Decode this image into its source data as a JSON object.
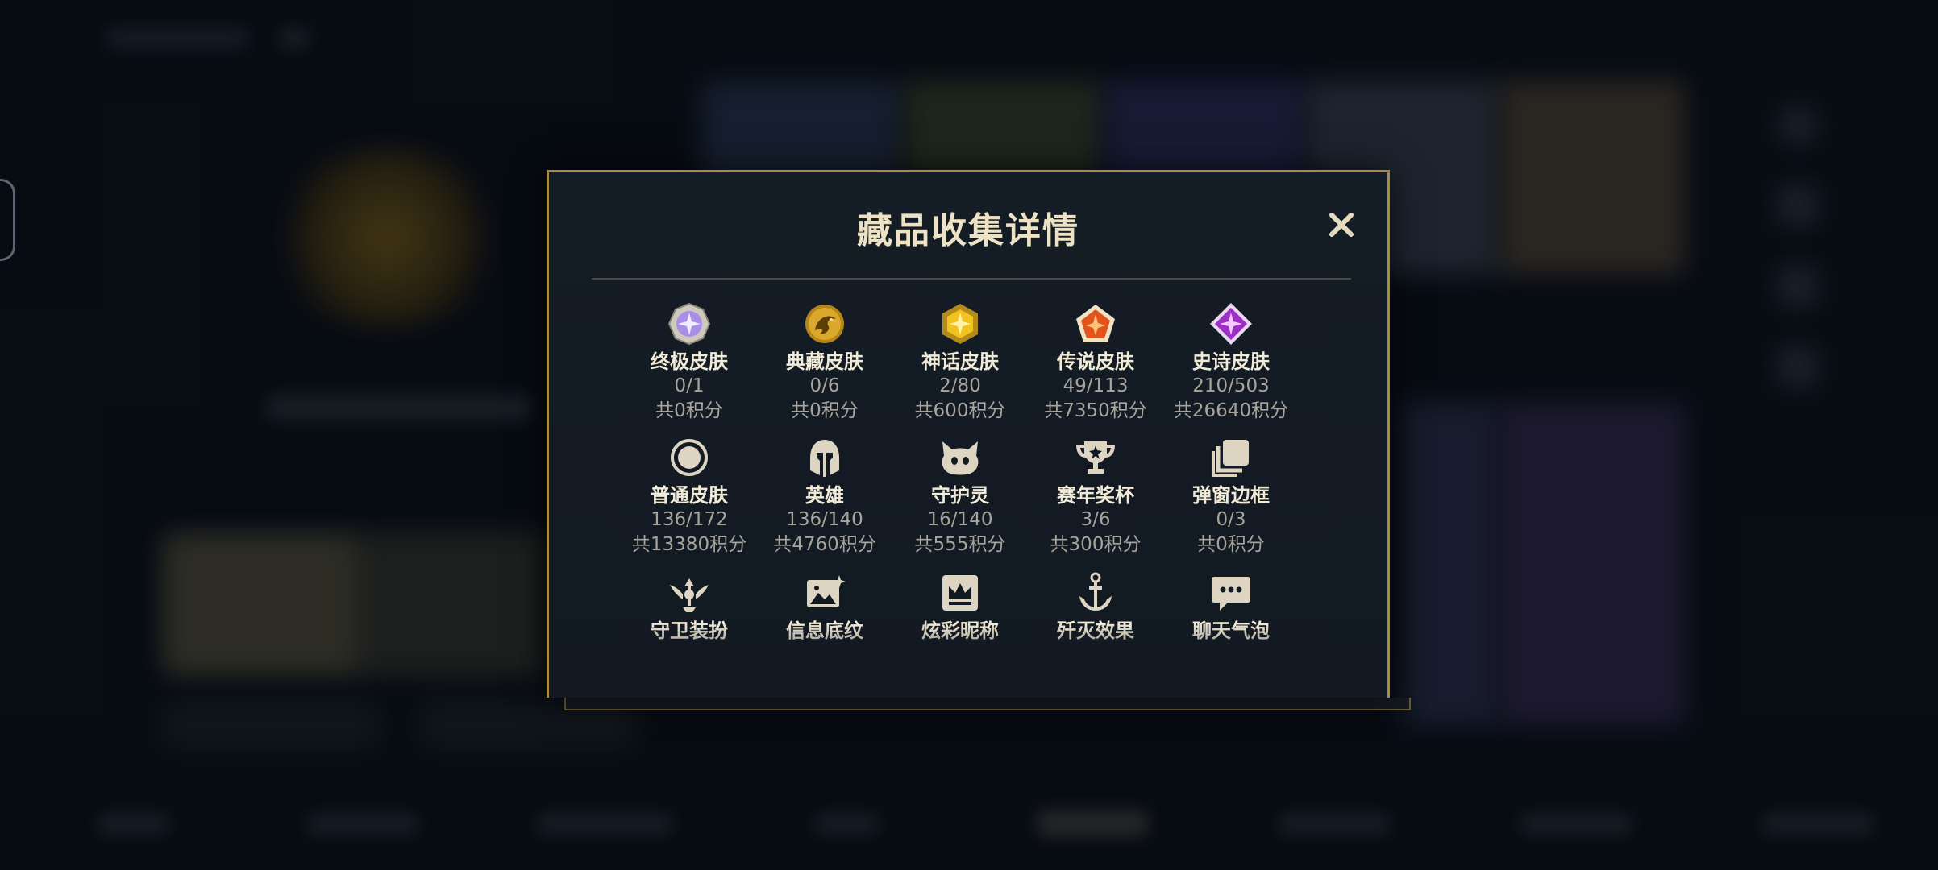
{
  "modal": {
    "title": "藏品收集详情",
    "close_label": "✕"
  },
  "categories": [
    {
      "name": "终极皮肤",
      "count": "0/1",
      "points": "共0积分",
      "icon": "ultimate-gem-icon"
    },
    {
      "name": "典藏皮肤",
      "count": "0/6",
      "points": "共0积分",
      "icon": "dragon-emblem-icon"
    },
    {
      "name": "神话皮肤",
      "count": "2/80",
      "points": "共600积分",
      "icon": "mythic-gem-icon"
    },
    {
      "name": "传说皮肤",
      "count": "49/113",
      "points": "共7350积分",
      "icon": "legendary-gem-icon"
    },
    {
      "name": "史诗皮肤",
      "count": "210/503",
      "points": "共26640积分",
      "icon": "epic-gem-icon"
    },
    {
      "name": "普通皮肤",
      "count": "136/172",
      "points": "共13380积分",
      "icon": "ring-icon"
    },
    {
      "name": "英雄",
      "count": "136/140",
      "points": "共4760积分",
      "icon": "helmet-icon"
    },
    {
      "name": "守护灵",
      "count": "16/140",
      "points": "共555积分",
      "icon": "guardian-face-icon"
    },
    {
      "name": "赛年奖杯",
      "count": "3/6",
      "points": "共300积分",
      "icon": "trophy-icon"
    },
    {
      "name": "弹窗边框",
      "count": "0/3",
      "points": "共0积分",
      "icon": "frame-stack-icon"
    },
    {
      "name": "守卫装扮",
      "icon": "ward-icon"
    },
    {
      "name": "信息底纹",
      "icon": "image-sparkle-icon"
    },
    {
      "name": "炫彩昵称",
      "icon": "crown-card-icon"
    },
    {
      "name": "歼灭效果",
      "icon": "anchor-icon"
    },
    {
      "name": "聊天气泡",
      "icon": "chat-bubble-icon"
    }
  ],
  "colors": {
    "modal_border": "#a88a47",
    "title": "#eee2c4",
    "label": "#f1ead6",
    "secondary": "#a7a49b"
  }
}
